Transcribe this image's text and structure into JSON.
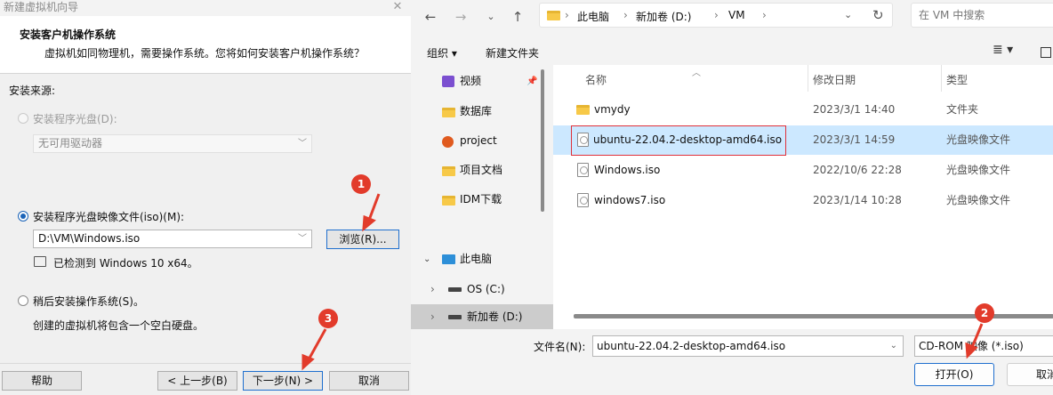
{
  "wizard": {
    "window_title": "新建虚拟机向导",
    "header_title": "安装客户机操作系统",
    "header_desc": "虚拟机如同物理机，需要操作系统。您将如何安装客户机操作系统？",
    "source_label": "安装来源:",
    "option_disc_label": "安装程序光盘(D):",
    "disc_drive_value": "无可用驱动器",
    "option_iso_label": "安装程序光盘映像文件(iso)(M):",
    "iso_path_value": "D:\\VM\\Windows.iso",
    "browse_button": "浏览(R)...",
    "detected_text": "已检测到 Windows 10 x64。",
    "option_later_label": "稍后安装操作系统(S)。",
    "later_desc": "创建的虚拟机将包含一个空白硬盘。",
    "help_button": "帮助",
    "back_button": "< 上一步(B)",
    "next_button": "下一步(N) >",
    "cancel_button": "取消"
  },
  "file_dialog": {
    "breadcrumb": [
      "此电脑",
      "新加卷 (D:)",
      "VM"
    ],
    "search_placeholder": "在 VM 中搜索",
    "organize_label": "组织 ▾",
    "new_folder_label": "新建文件夹",
    "nav_items": [
      {
        "label": "视频",
        "icon": "video-icon"
      },
      {
        "label": "数据库",
        "icon": "folder-icon"
      },
      {
        "label": "project",
        "icon": "project-icon"
      },
      {
        "label": "项目文档",
        "icon": "folder-icon"
      },
      {
        "label": "IDM下载",
        "icon": "folder-icon"
      },
      {
        "label": "此电脑",
        "icon": "computer-icon"
      },
      {
        "label": "OS (C:)",
        "icon": "drive-icon"
      },
      {
        "label": "新加卷 (D:)",
        "icon": "drive-icon"
      }
    ],
    "columns": [
      "名称",
      "修改日期",
      "类型"
    ],
    "files": [
      {
        "name": "vmydy",
        "date": "2023/3/1 14:40",
        "type": "文件夹",
        "kind": "folder"
      },
      {
        "name": "ubuntu-22.04.2-desktop-amd64.iso",
        "date": "2023/3/1 14:59",
        "type": "光盘映像文件",
        "kind": "iso"
      },
      {
        "name": "Windows.iso",
        "date": "2022/10/6 22:28",
        "type": "光盘映像文件",
        "kind": "iso"
      },
      {
        "name": "windows7.iso",
        "date": "2023/1/14 10:28",
        "type": "光盘映像文件",
        "kind": "iso"
      }
    ],
    "filename_label": "文件名(N):",
    "filename_value": "ubuntu-22.04.2-desktop-amd64.iso",
    "filetype_value": "CD-ROM 映像 (*.iso)",
    "open_button": "打开(O)",
    "cancel_button": "取消"
  },
  "annotations": [
    "1",
    "2",
    "3"
  ],
  "colors": {
    "annotation": "#e23b2b",
    "selection": "#cce8ff",
    "accent": "#1a63b8"
  }
}
